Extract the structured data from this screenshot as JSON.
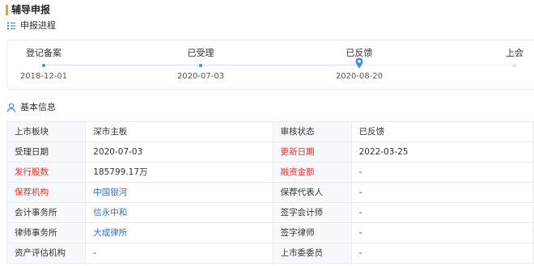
{
  "header": {
    "title": "辅导申报"
  },
  "progress": {
    "section_title": "申报进程",
    "icon": "progress-list-icon",
    "steps": [
      {
        "label": "登记备案",
        "date": "2018-12-01",
        "state": "done"
      },
      {
        "label": "已受理",
        "date": "2020-07-03",
        "state": "done"
      },
      {
        "label": "已反馈",
        "date": "2020-08-20",
        "state": "current"
      },
      {
        "label": "上会",
        "date": "",
        "state": "pending"
      }
    ]
  },
  "basic_info": {
    "section_title": "基本信息",
    "icon": "user-icon",
    "rows": [
      {
        "k1": "上市板块",
        "v1": "深市主板",
        "k2": "审核状态",
        "v2": "已反馈"
      },
      {
        "k1": "受理日期",
        "v1": "2020-07-03",
        "k2": "更新日期",
        "v2": "2022-03-25"
      },
      {
        "k1": "发行股数",
        "v1": "185799.17万",
        "k2": "融资金额",
        "v2": "-"
      },
      {
        "k1": "保荐机构",
        "v1": "中国银河",
        "k2": "保荐代表人",
        "v2": "-"
      },
      {
        "k1": "会计事务所",
        "v1": "信永中和",
        "k2": "签字会计师",
        "v2": "-"
      },
      {
        "k1": "律师事务所",
        "v1": "大成律所",
        "k2": "签字律师",
        "v2": "-"
      },
      {
        "k1": "资产评估机构",
        "v1": "-",
        "k2": "上市委委员",
        "v2": "-"
      }
    ]
  },
  "colors": {
    "accent_bar": "#f0a020",
    "link": "#2d6fd6",
    "highlight_label": "#e8322a",
    "progress_dot": "#3f8ee8"
  }
}
